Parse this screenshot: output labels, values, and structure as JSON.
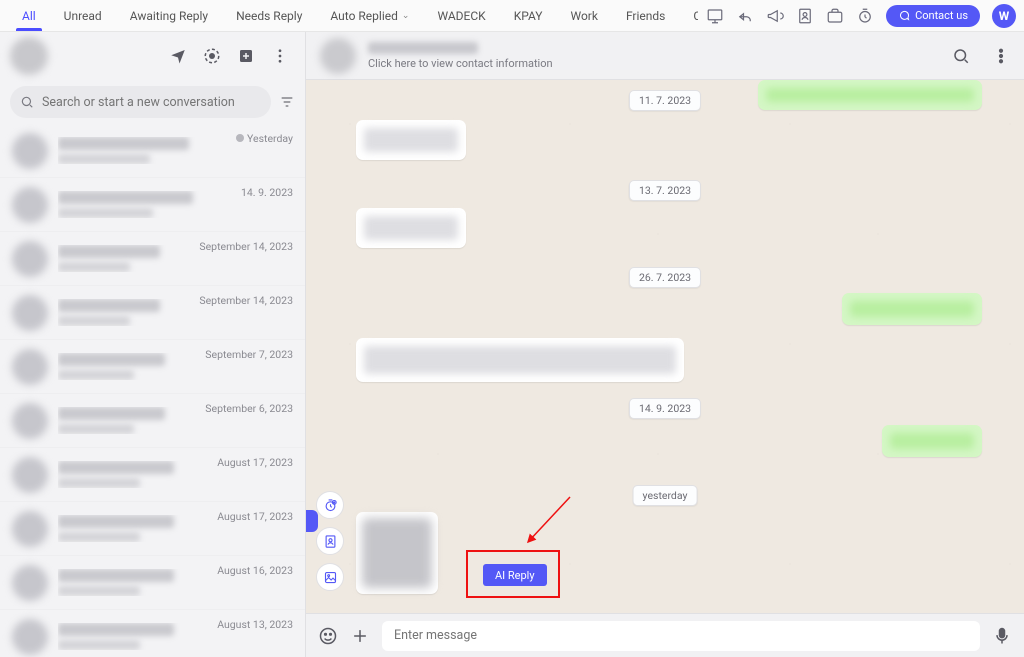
{
  "colors": {
    "accent": "#5458f6",
    "error": "#e11"
  },
  "topbar": {
    "tabs": [
      {
        "label": "All",
        "active": true
      },
      {
        "label": "Unread"
      },
      {
        "label": "Awaiting Reply"
      },
      {
        "label": "Needs Reply"
      },
      {
        "label": "Auto Replied",
        "chevron": true
      },
      {
        "label": "WADECK"
      },
      {
        "label": "KPAY"
      },
      {
        "label": "Work"
      },
      {
        "label": "Friends"
      },
      {
        "label": "Cu"
      }
    ],
    "contact_label": "Contact us",
    "brand_letter": "W",
    "icons": [
      "monitor-icon",
      "reply-icon",
      "megaphone-icon",
      "address-book-icon",
      "briefcase-icon",
      "clock-icon"
    ]
  },
  "search": {
    "placeholder": "Search or start a new conversation"
  },
  "conversations": [
    {
      "time": "Yesterday",
      "dot": true
    },
    {
      "time": "14. 9. 2023"
    },
    {
      "time": "September 14, 2023"
    },
    {
      "time": "September 14, 2023"
    },
    {
      "time": "September 7, 2023"
    },
    {
      "time": "September 6, 2023"
    },
    {
      "time": "August 17, 2023"
    },
    {
      "time": "August 17, 2023"
    },
    {
      "time": "August 16, 2023"
    },
    {
      "time": "August 13, 2023"
    }
  ],
  "chat": {
    "header_subtitle": "Click here to view contact information",
    "dates": {
      "d1": "11. 7. 2023",
      "d2": "13. 7. 2023",
      "d3": "26. 7. 2023",
      "d4": "14. 9. 2023",
      "d5": "yesterday"
    },
    "ai_reply_label": "AI Reply",
    "composer_placeholder": "Enter message"
  }
}
